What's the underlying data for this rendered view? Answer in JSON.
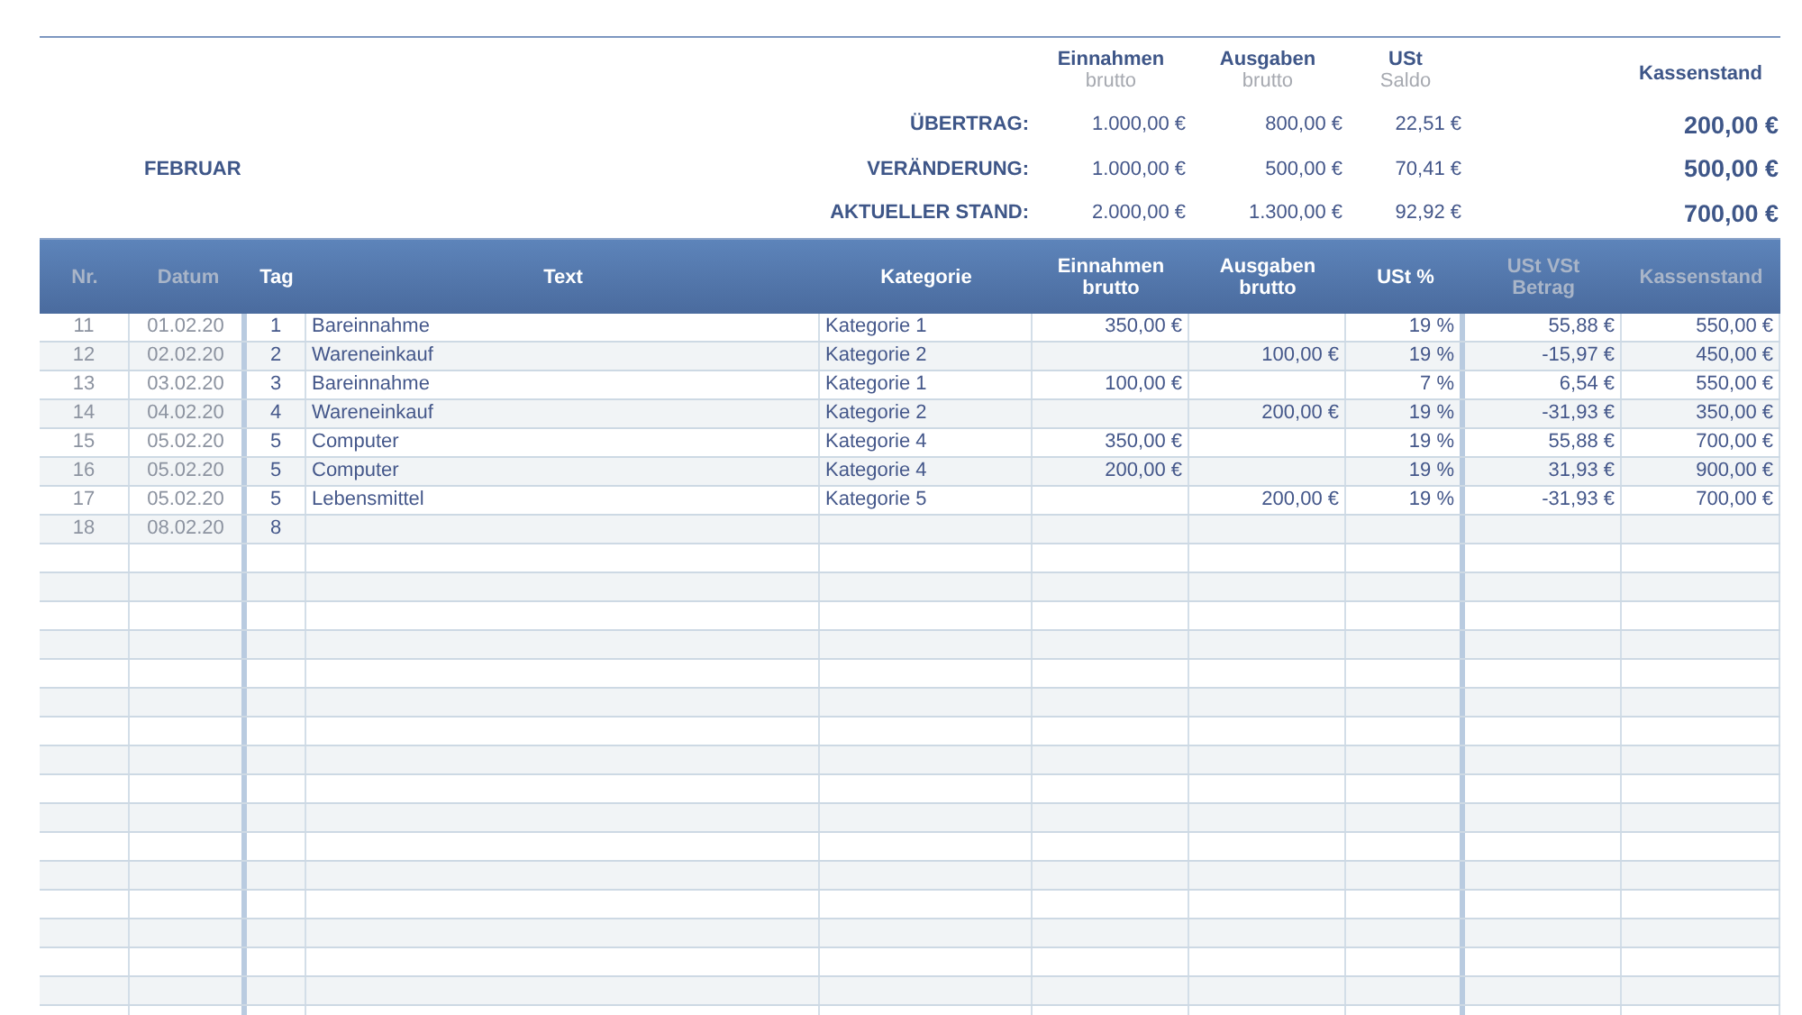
{
  "summary": {
    "month": "FEBRUAR",
    "headers": [
      {
        "title": "Einnahmen",
        "subtitle": "brutto"
      },
      {
        "title": "Ausgaben",
        "subtitle": "brutto"
      },
      {
        "title": "USt",
        "subtitle": "Saldo"
      }
    ],
    "balance_header": "Kassenstand",
    "rows": [
      {
        "label": "ÜBERTRAG:",
        "income": "1.000,00 €",
        "expenses": "800,00 €",
        "vat": "22,51 €",
        "balance": "200,00 €"
      },
      {
        "label": "VERÄNDERUNG:",
        "income": "1.000,00 €",
        "expenses": "500,00 €",
        "vat": "70,41 €",
        "balance": "500,00 €"
      },
      {
        "label": "AKTUELLER STAND:",
        "income": "2.000,00 €",
        "expenses": "1.300,00 €",
        "vat": "92,92 €",
        "balance": "700,00 €"
      }
    ]
  },
  "table": {
    "columns": [
      {
        "label": "Nr.",
        "dimmed": true
      },
      {
        "label": "Datum",
        "dimmed": true
      },
      {
        "label": "Tag",
        "dimmed": false
      },
      {
        "label": "Text",
        "dimmed": false
      },
      {
        "label": "Kategorie",
        "dimmed": false
      },
      {
        "label": "Einnahmen\nbrutto",
        "dimmed": false
      },
      {
        "label": "Ausgaben\nbrutto",
        "dimmed": false
      },
      {
        "label": "USt %",
        "dimmed": false
      },
      {
        "label": "USt   VSt\nBetrag",
        "dimmed": true
      },
      {
        "label": "Kassenstand",
        "dimmed": true
      }
    ],
    "rows": [
      [
        "11",
        "01.02.20",
        "1",
        "Bareinnahme",
        "Kategorie 1",
        "350,00 €",
        null,
        "19 %",
        "55,88 €",
        "550,00 €"
      ],
      [
        "12",
        "02.02.20",
        "2",
        "Wareneinkauf",
        "Kategorie 2",
        null,
        "100,00 €",
        "19 %",
        "-15,97 €",
        "450,00 €"
      ],
      [
        "13",
        "03.02.20",
        "3",
        "Bareinnahme",
        "Kategorie 1",
        "100,00 €",
        null,
        "7 %",
        "6,54 €",
        "550,00 €"
      ],
      [
        "14",
        "04.02.20",
        "4",
        "Wareneinkauf",
        "Kategorie 2",
        null,
        "200,00 €",
        "19 %",
        "-31,93 €",
        "350,00 €"
      ],
      [
        "15",
        "05.02.20",
        "5",
        "Computer",
        "Kategorie 4",
        "350,00 €",
        null,
        "19 %",
        "55,88 €",
        "700,00 €"
      ],
      [
        "16",
        "05.02.20",
        "5",
        "Computer",
        "Kategorie 4",
        "200,00 €",
        null,
        "19 %",
        "31,93 €",
        "900,00 €"
      ],
      [
        "17",
        "05.02.20",
        "5",
        "Lebensmittel",
        "Kategorie 5",
        null,
        "200,00 €",
        "19 %",
        "-31,93 €",
        "700,00 €"
      ],
      [
        "18",
        "08.02.20",
        "8"
      ]
    ]
  }
}
